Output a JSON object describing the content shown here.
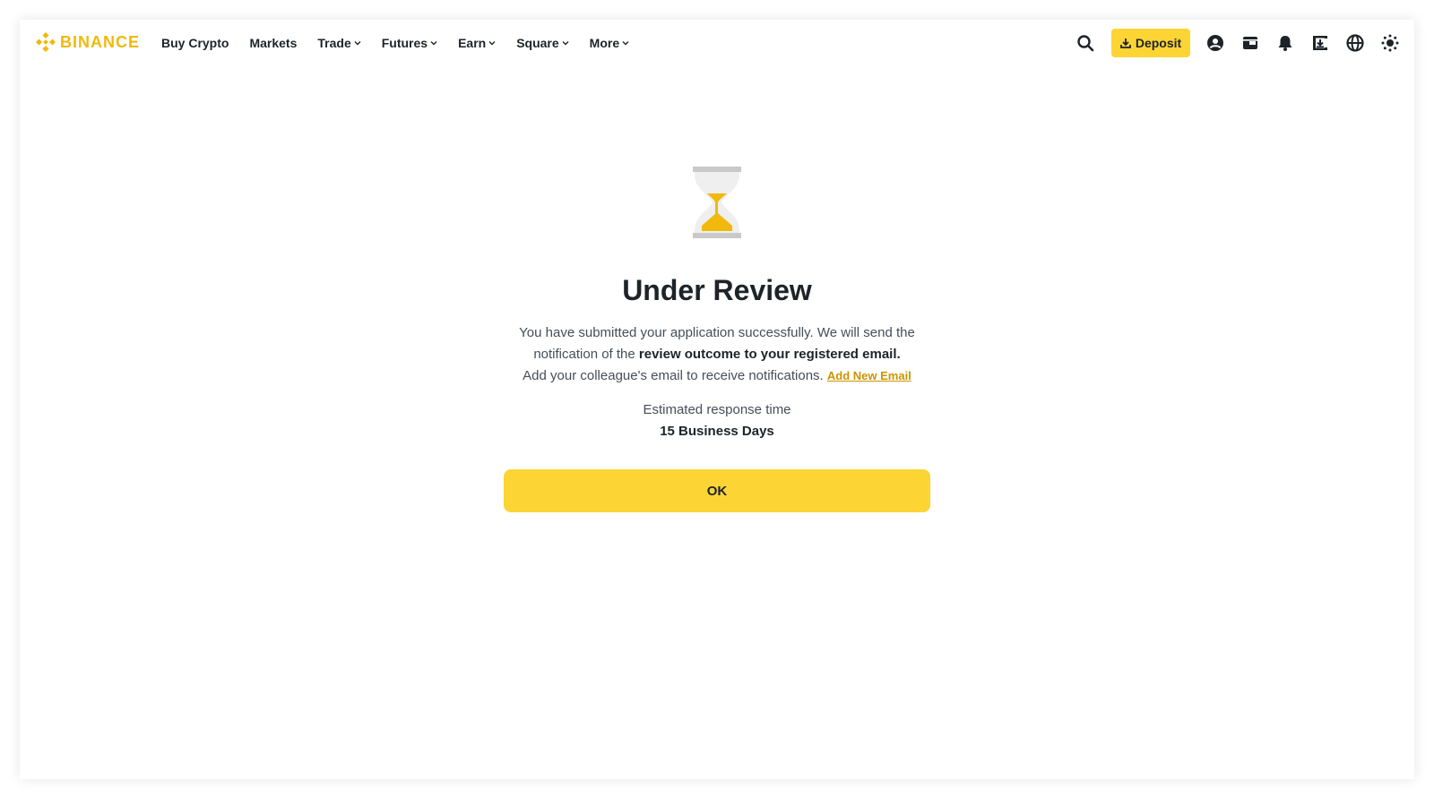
{
  "brand": {
    "name": "BINANCE",
    "color": "#F0B90B"
  },
  "nav": {
    "items": [
      {
        "label": "Buy Crypto",
        "dropdown": false
      },
      {
        "label": "Markets",
        "dropdown": false
      },
      {
        "label": "Trade",
        "dropdown": true
      },
      {
        "label": "Futures",
        "dropdown": true
      },
      {
        "label": "Earn",
        "dropdown": true
      },
      {
        "label": "Square",
        "dropdown": true
      },
      {
        "label": "More",
        "dropdown": true
      }
    ]
  },
  "header": {
    "deposit_label": "Deposit",
    "icons": [
      "search-icon",
      "download-icon",
      "user-icon",
      "wallet-icon",
      "bell-icon",
      "qr-download-icon",
      "globe-icon",
      "theme-icon"
    ]
  },
  "review": {
    "icon": "hourglass-icon",
    "title": "Under Review",
    "line1": "You have submitted your application successfully. We will send the notification of the ",
    "line1_bold": "review outcome to your registered email.",
    "line2": "Add your colleague's email to receive notifications.",
    "add_email_link": "Add New Email",
    "estimated_label": "Estimated response time",
    "estimated_value": "15 Business Days",
    "ok_label": "OK"
  },
  "colors": {
    "accent": "#FCD535",
    "link": "#C99400",
    "text": "#1E2329"
  }
}
